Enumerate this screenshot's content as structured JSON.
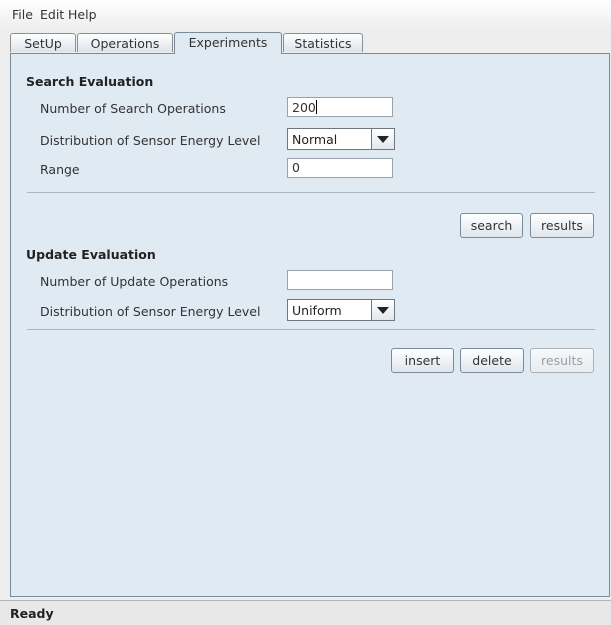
{
  "menubar": {
    "file": "File",
    "edit": "Edit",
    "help": "Help"
  },
  "tabs": [
    "SetUp",
    "Operations",
    "Experiments",
    "Statistics"
  ],
  "active_tab": "Experiments",
  "search": {
    "title": "Search Evaluation",
    "num_ops_label": "Number of Search Operations",
    "num_ops_value": "200",
    "dist_label": "Distribution of Sensor Energy Level",
    "dist_value": "Normal",
    "range_label": "Range",
    "range_value": "0",
    "search_button": "search",
    "results_button": "results"
  },
  "update": {
    "title": "Update Evaluation",
    "num_ops_label": "Number of Update Operations",
    "num_ops_value": "",
    "dist_label": "Distribution of Sensor Energy Level",
    "dist_value": "Uniform",
    "insert_button": "insert",
    "delete_button": "delete",
    "results_button": "results"
  },
  "status": "Ready",
  "colors": {
    "panel_bg": "#e0eaf3",
    "border": "#7a8a99"
  }
}
